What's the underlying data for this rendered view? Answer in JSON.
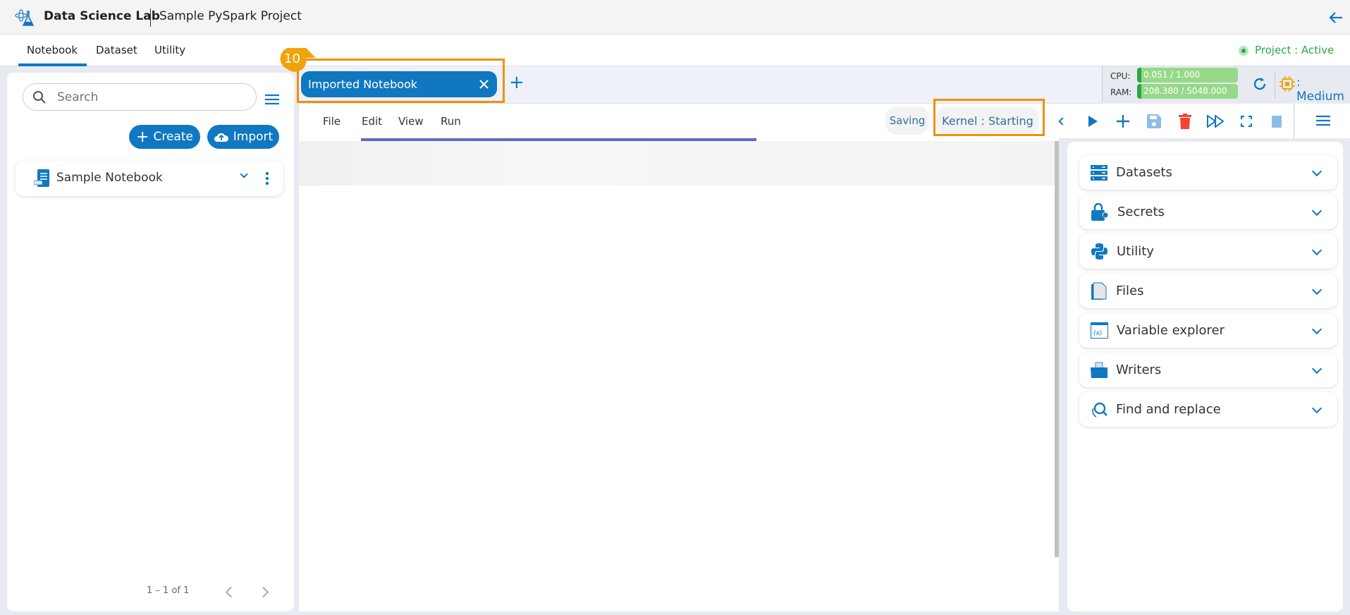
{
  "header": {
    "app_name": "Data Science Lab",
    "project_name": "Sample PySpark Project"
  },
  "tabs": [
    {
      "label": "Notebook"
    },
    {
      "label": "Dataset"
    },
    {
      "label": "Utility"
    }
  ],
  "project_status": "Project : Active",
  "left": {
    "search_placeholder": "Search",
    "create_label": "Create",
    "import_label": "Import",
    "notebook_name": "Sample Notebook",
    "pagination": "1 – 1 of 1"
  },
  "notebook_tab": {
    "label": "Imported Notebook",
    "badge": "10"
  },
  "resources": {
    "cpu_label": "CPU:",
    "cpu_value": "0.051 / 1.000",
    "ram_label": "RAM:",
    "ram_value": "208.380 / 5048.000",
    "size": ": Medium"
  },
  "menu": [
    "File",
    "Edit",
    "View",
    "Run"
  ],
  "status": {
    "saving": "Saving",
    "kernel": "Kernel : Starting"
  },
  "right_panel": [
    {
      "label": "Datasets"
    },
    {
      "label": "Secrets"
    },
    {
      "label": "Utility"
    },
    {
      "label": "Files"
    },
    {
      "label": "Variable explorer"
    },
    {
      "label": "Writers"
    },
    {
      "label": "Find and replace"
    }
  ],
  "colors": {
    "primary": "#0f78c0",
    "highlight": "#f0900a",
    "active": "#2aa845"
  }
}
